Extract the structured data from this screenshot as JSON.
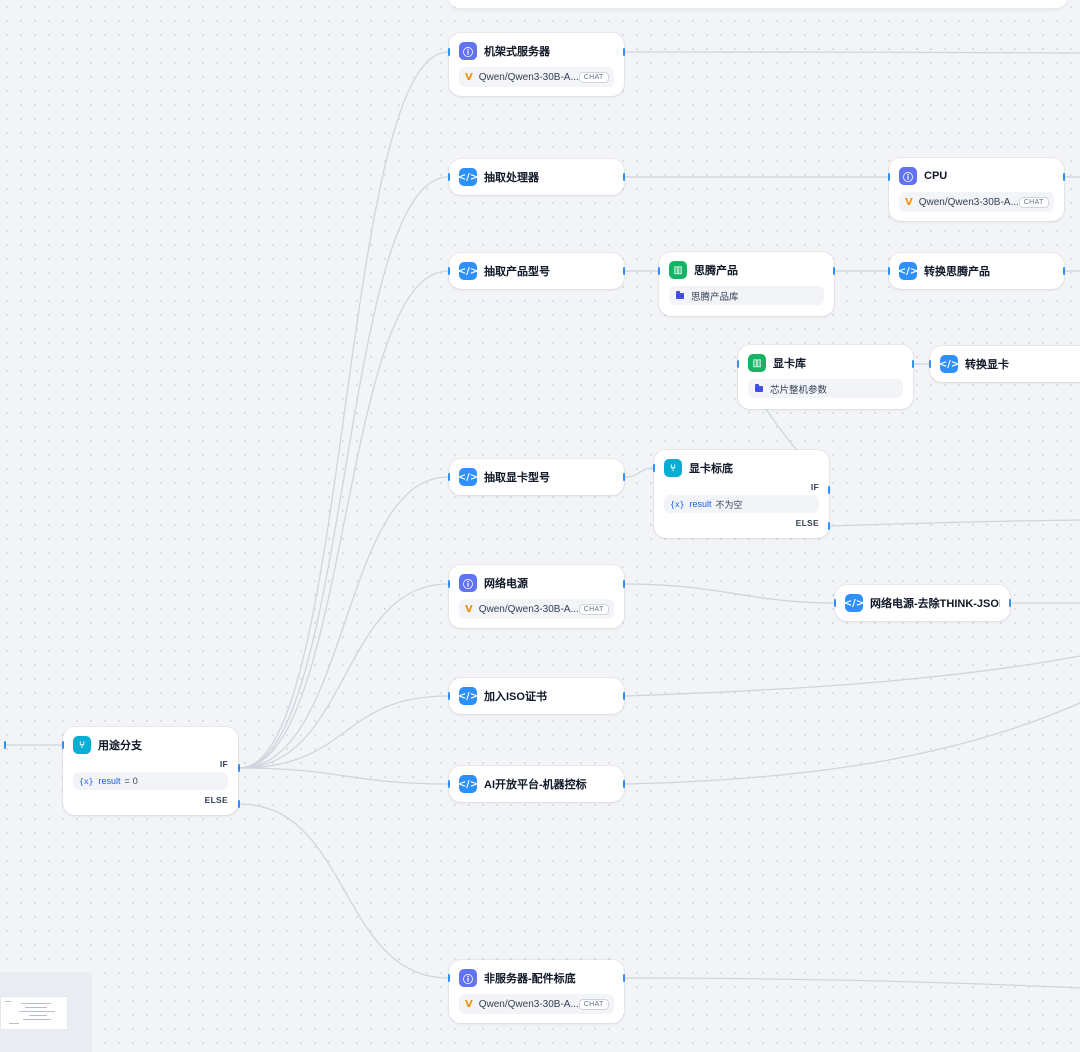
{
  "nodes": {
    "rack_server": {
      "title": "机架式服务器",
      "model": "Qwen/Qwen3-30B-A...",
      "badge": "CHAT",
      "icon": "llm-icon"
    },
    "extract_processor": {
      "title": "抽取处理器",
      "icon": "code-icon"
    },
    "cpu": {
      "title": "CPU",
      "model": "Qwen/Qwen3-30B-A...",
      "badge": "CHAT",
      "icon": "llm-icon"
    },
    "extract_model": {
      "title": "抽取产品型号",
      "icon": "code-icon"
    },
    "sitang_product": {
      "title": "思腾产品",
      "kb": "思腾产品库",
      "icon": "knowledge-icon"
    },
    "convert_sitang": {
      "title": "转换思腾产品",
      "icon": "code-icon"
    },
    "gpu_lib": {
      "title": "显卡库",
      "kb": "芯片整机参数",
      "icon": "knowledge-icon"
    },
    "convert_gpu": {
      "title": "转换显卡",
      "icon": "code-icon"
    },
    "extract_gpu": {
      "title": "抽取显卡型号",
      "icon": "code-icon"
    },
    "gpu_bid": {
      "title": "显卡标底",
      "if_label": "IF",
      "var_icon": "{x}",
      "var": "result",
      "op": "",
      "value": "不为空",
      "else_label": "ELSE",
      "icon": "branch-icon"
    },
    "network_power": {
      "title": "网络电源",
      "model": "Qwen/Qwen3-30B-A...",
      "badge": "CHAT",
      "icon": "llm-icon"
    },
    "network_power_strip": {
      "title": "网络电源-去除THINK-JSON-S",
      "icon": "code-icon"
    },
    "iso_cert": {
      "title": "加入ISO证书",
      "icon": "code-icon"
    },
    "ai_platform": {
      "title": "AI开放平台-机器控标",
      "icon": "code-icon"
    },
    "usage_branch": {
      "title": "用途分支",
      "if_label": "IF",
      "var_icon": "{x}",
      "var": "result",
      "op": "=",
      "value": "0",
      "else_label": "ELSE",
      "icon": "branch-icon"
    },
    "non_server": {
      "title": "非服务器-配件标底",
      "model": "Qwen/Qwen3-30B-A...",
      "badge": "CHAT",
      "icon": "llm-icon"
    }
  },
  "colors": {
    "edge": "#d0d5dd",
    "handle": "#2e90fa",
    "llm": "#6172f3",
    "code": "#2e90fa",
    "knowledge": "#16b364",
    "branch": "#06aed4"
  }
}
